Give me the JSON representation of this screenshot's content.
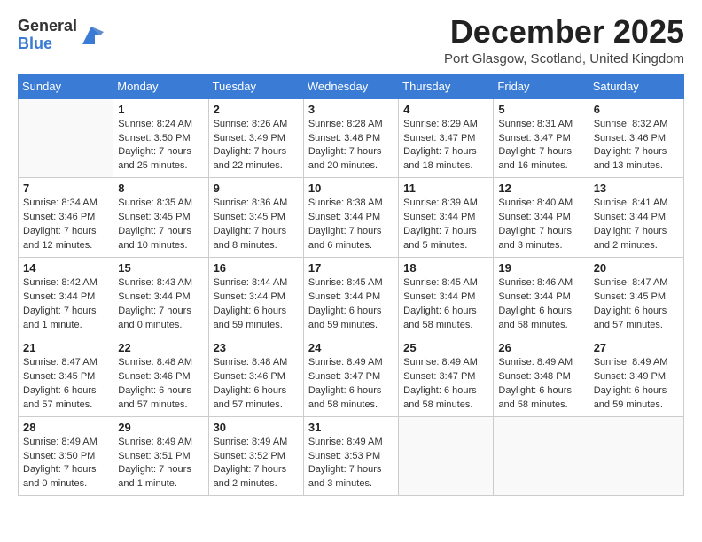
{
  "header": {
    "logo_general": "General",
    "logo_blue": "Blue",
    "month_title": "December 2025",
    "location": "Port Glasgow, Scotland, United Kingdom"
  },
  "calendar": {
    "days_of_week": [
      "Sunday",
      "Monday",
      "Tuesday",
      "Wednesday",
      "Thursday",
      "Friday",
      "Saturday"
    ],
    "weeks": [
      [
        {
          "day": "",
          "info": ""
        },
        {
          "day": "1",
          "info": "Sunrise: 8:24 AM\nSunset: 3:50 PM\nDaylight: 7 hours\nand 25 minutes."
        },
        {
          "day": "2",
          "info": "Sunrise: 8:26 AM\nSunset: 3:49 PM\nDaylight: 7 hours\nand 22 minutes."
        },
        {
          "day": "3",
          "info": "Sunrise: 8:28 AM\nSunset: 3:48 PM\nDaylight: 7 hours\nand 20 minutes."
        },
        {
          "day": "4",
          "info": "Sunrise: 8:29 AM\nSunset: 3:47 PM\nDaylight: 7 hours\nand 18 minutes."
        },
        {
          "day": "5",
          "info": "Sunrise: 8:31 AM\nSunset: 3:47 PM\nDaylight: 7 hours\nand 16 minutes."
        },
        {
          "day": "6",
          "info": "Sunrise: 8:32 AM\nSunset: 3:46 PM\nDaylight: 7 hours\nand 13 minutes."
        }
      ],
      [
        {
          "day": "7",
          "info": "Sunrise: 8:34 AM\nSunset: 3:46 PM\nDaylight: 7 hours\nand 12 minutes."
        },
        {
          "day": "8",
          "info": "Sunrise: 8:35 AM\nSunset: 3:45 PM\nDaylight: 7 hours\nand 10 minutes."
        },
        {
          "day": "9",
          "info": "Sunrise: 8:36 AM\nSunset: 3:45 PM\nDaylight: 7 hours\nand 8 minutes."
        },
        {
          "day": "10",
          "info": "Sunrise: 8:38 AM\nSunset: 3:44 PM\nDaylight: 7 hours\nand 6 minutes."
        },
        {
          "day": "11",
          "info": "Sunrise: 8:39 AM\nSunset: 3:44 PM\nDaylight: 7 hours\nand 5 minutes."
        },
        {
          "day": "12",
          "info": "Sunrise: 8:40 AM\nSunset: 3:44 PM\nDaylight: 7 hours\nand 3 minutes."
        },
        {
          "day": "13",
          "info": "Sunrise: 8:41 AM\nSunset: 3:44 PM\nDaylight: 7 hours\nand 2 minutes."
        }
      ],
      [
        {
          "day": "14",
          "info": "Sunrise: 8:42 AM\nSunset: 3:44 PM\nDaylight: 7 hours\nand 1 minute."
        },
        {
          "day": "15",
          "info": "Sunrise: 8:43 AM\nSunset: 3:44 PM\nDaylight: 7 hours\nand 0 minutes."
        },
        {
          "day": "16",
          "info": "Sunrise: 8:44 AM\nSunset: 3:44 PM\nDaylight: 6 hours\nand 59 minutes."
        },
        {
          "day": "17",
          "info": "Sunrise: 8:45 AM\nSunset: 3:44 PM\nDaylight: 6 hours\nand 59 minutes."
        },
        {
          "day": "18",
          "info": "Sunrise: 8:45 AM\nSunset: 3:44 PM\nDaylight: 6 hours\nand 58 minutes."
        },
        {
          "day": "19",
          "info": "Sunrise: 8:46 AM\nSunset: 3:44 PM\nDaylight: 6 hours\nand 58 minutes."
        },
        {
          "day": "20",
          "info": "Sunrise: 8:47 AM\nSunset: 3:45 PM\nDaylight: 6 hours\nand 57 minutes."
        }
      ],
      [
        {
          "day": "21",
          "info": "Sunrise: 8:47 AM\nSunset: 3:45 PM\nDaylight: 6 hours\nand 57 minutes."
        },
        {
          "day": "22",
          "info": "Sunrise: 8:48 AM\nSunset: 3:46 PM\nDaylight: 6 hours\nand 57 minutes."
        },
        {
          "day": "23",
          "info": "Sunrise: 8:48 AM\nSunset: 3:46 PM\nDaylight: 6 hours\nand 57 minutes."
        },
        {
          "day": "24",
          "info": "Sunrise: 8:49 AM\nSunset: 3:47 PM\nDaylight: 6 hours\nand 58 minutes."
        },
        {
          "day": "25",
          "info": "Sunrise: 8:49 AM\nSunset: 3:47 PM\nDaylight: 6 hours\nand 58 minutes."
        },
        {
          "day": "26",
          "info": "Sunrise: 8:49 AM\nSunset: 3:48 PM\nDaylight: 6 hours\nand 58 minutes."
        },
        {
          "day": "27",
          "info": "Sunrise: 8:49 AM\nSunset: 3:49 PM\nDaylight: 6 hours\nand 59 minutes."
        }
      ],
      [
        {
          "day": "28",
          "info": "Sunrise: 8:49 AM\nSunset: 3:50 PM\nDaylight: 7 hours\nand 0 minutes."
        },
        {
          "day": "29",
          "info": "Sunrise: 8:49 AM\nSunset: 3:51 PM\nDaylight: 7 hours\nand 1 minute."
        },
        {
          "day": "30",
          "info": "Sunrise: 8:49 AM\nSunset: 3:52 PM\nDaylight: 7 hours\nand 2 minutes."
        },
        {
          "day": "31",
          "info": "Sunrise: 8:49 AM\nSunset: 3:53 PM\nDaylight: 7 hours\nand 3 minutes."
        },
        {
          "day": "",
          "info": ""
        },
        {
          "day": "",
          "info": ""
        },
        {
          "day": "",
          "info": ""
        }
      ]
    ]
  }
}
